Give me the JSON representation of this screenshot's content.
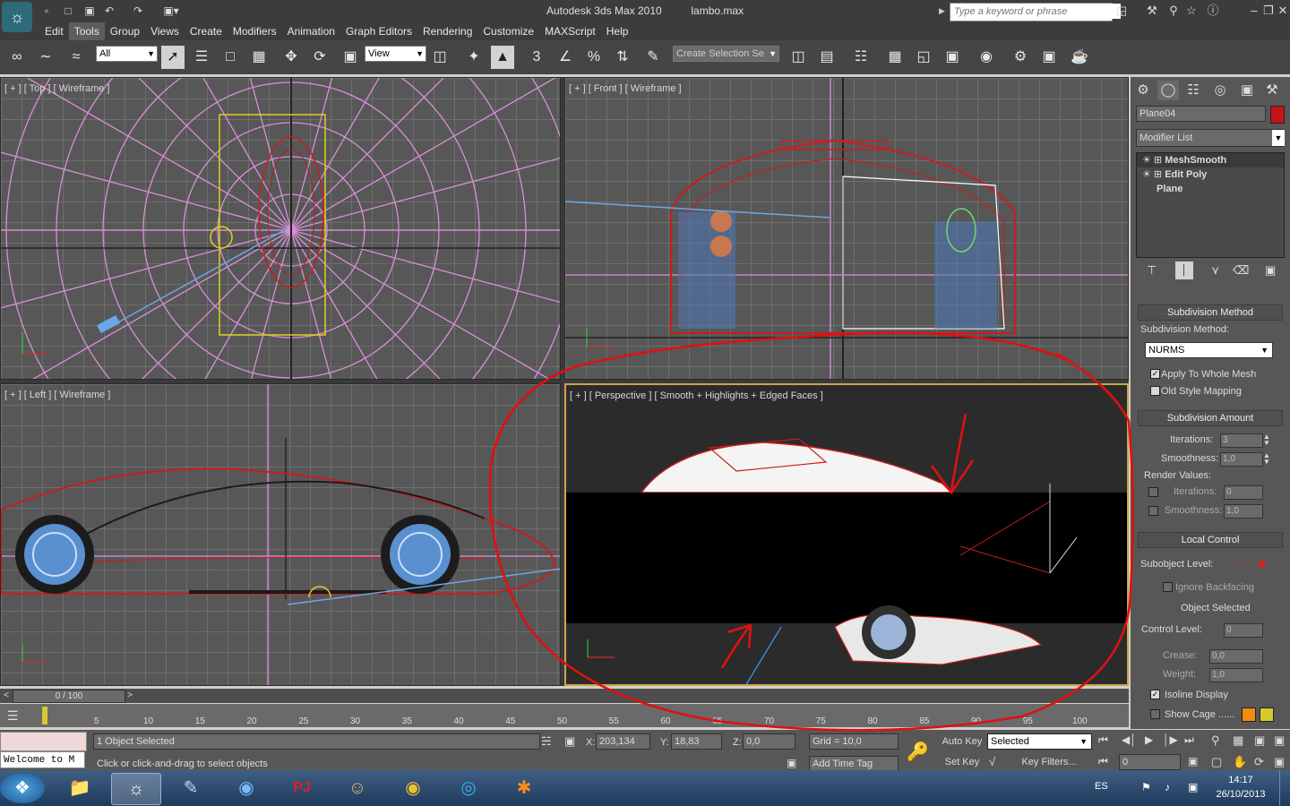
{
  "titlebar": {
    "app_title": "Autodesk 3ds Max  2010",
    "file_name": "lambo.max",
    "search_placeholder": "Type a keyword or phrase",
    "app_logo": "3ds-max-logo"
  },
  "menus": [
    "Edit",
    "Tools",
    "Group",
    "Views",
    "Create",
    "Modifiers",
    "Animation",
    "Graph Editors",
    "Rendering",
    "Customize",
    "MAXScript",
    "Help"
  ],
  "active_menu": "Tools",
  "toolbar": {
    "selection_filter": "All",
    "ref_coord": "View",
    "named_selection": "Create Selection Se"
  },
  "viewports": {
    "top_label": "[ + ] [ Top ] [ Wireframe ]",
    "front_label": "[ + ] [ Front ] [ Wireframe ]",
    "left_label": "[ + ] [ Left ] [ Wireframe ]",
    "perspective_label": "[ + ] [ Perspective ] [ Smooth + Highlights + Edged Faces ]",
    "active_border_color": "#c8a64a",
    "grid_color": "#6e6e6e",
    "wire_red": "#c81e1e",
    "wire_pink": "#d890d8",
    "annotation_color": "#e01010"
  },
  "command_panel": {
    "object_name": "Plane04",
    "object_color": "#c81414",
    "modifier_list_label": "Modifier List",
    "stack": [
      "MeshSmooth",
      "Edit Poly",
      "Plane"
    ],
    "subdivision_method": {
      "header": "Subdivision Method",
      "label": "Subdivision Method:",
      "value": "NURMS",
      "apply_whole_mesh": "Apply To Whole Mesh",
      "old_style_mapping": "Old Style Mapping"
    },
    "subdivision_amount": {
      "header": "Subdivision Amount",
      "iterations_label": "Iterations:",
      "iterations": "3",
      "smoothness_label": "Smoothness:",
      "smoothness": "1,0",
      "render_values_label": "Render Values:",
      "render_iterations_label": "Iterations:",
      "render_iterations": "0",
      "render_smoothness_label": "Smoothness:",
      "render_smoothness": "1,0"
    },
    "local_control": {
      "header": "Local Control",
      "subobject_label": "Subobject Level:",
      "ignore_backfacing": "Ignore Backfacing",
      "object_selected": "Object Selected",
      "control_level_label": "Control Level:",
      "control_level": "0",
      "crease_label": "Crease:",
      "crease": "0,0",
      "weight_label": "Weight:",
      "weight": "1,0",
      "isoline_display": "Isoline Display",
      "show_cage": "Show Cage ......",
      "cage_color_1": "#f08c10",
      "cage_color_2": "#d8c830"
    }
  },
  "timeline": {
    "frame_display": "0 / 100",
    "ticks": [
      "5",
      "10",
      "15",
      "20",
      "25",
      "30",
      "35",
      "40",
      "45",
      "50",
      "55",
      "60",
      "65",
      "70",
      "75",
      "80",
      "85",
      "90",
      "95",
      "100"
    ]
  },
  "status": {
    "listener": "Welcome to M",
    "selected_count": "1 Object Selected",
    "prompt": "Click or click-and-drag to select objects",
    "x_label": "X:",
    "x": "203,134",
    "y_label": "Y:",
    "y": "18,83",
    "z_label": "Z:",
    "z": "0,0",
    "grid": "Grid = 10,0",
    "add_time_tag": "Add Time Tag",
    "auto_key": "Auto Key",
    "set_key": "Set Key",
    "key_mode": "Selected",
    "key_filters": "Key Filters...",
    "frame": "0"
  },
  "taskbar": {
    "apps": [
      "start-orb",
      "explorer-icon",
      "3dsmax-icon",
      "notepad-icon",
      "google-earth-icon",
      "pj64-icon",
      "game-icon",
      "chrome-icon",
      "skype-icon",
      "avast-icon"
    ],
    "lang": "ES",
    "time": "14:17",
    "date": "26/10/2013"
  }
}
